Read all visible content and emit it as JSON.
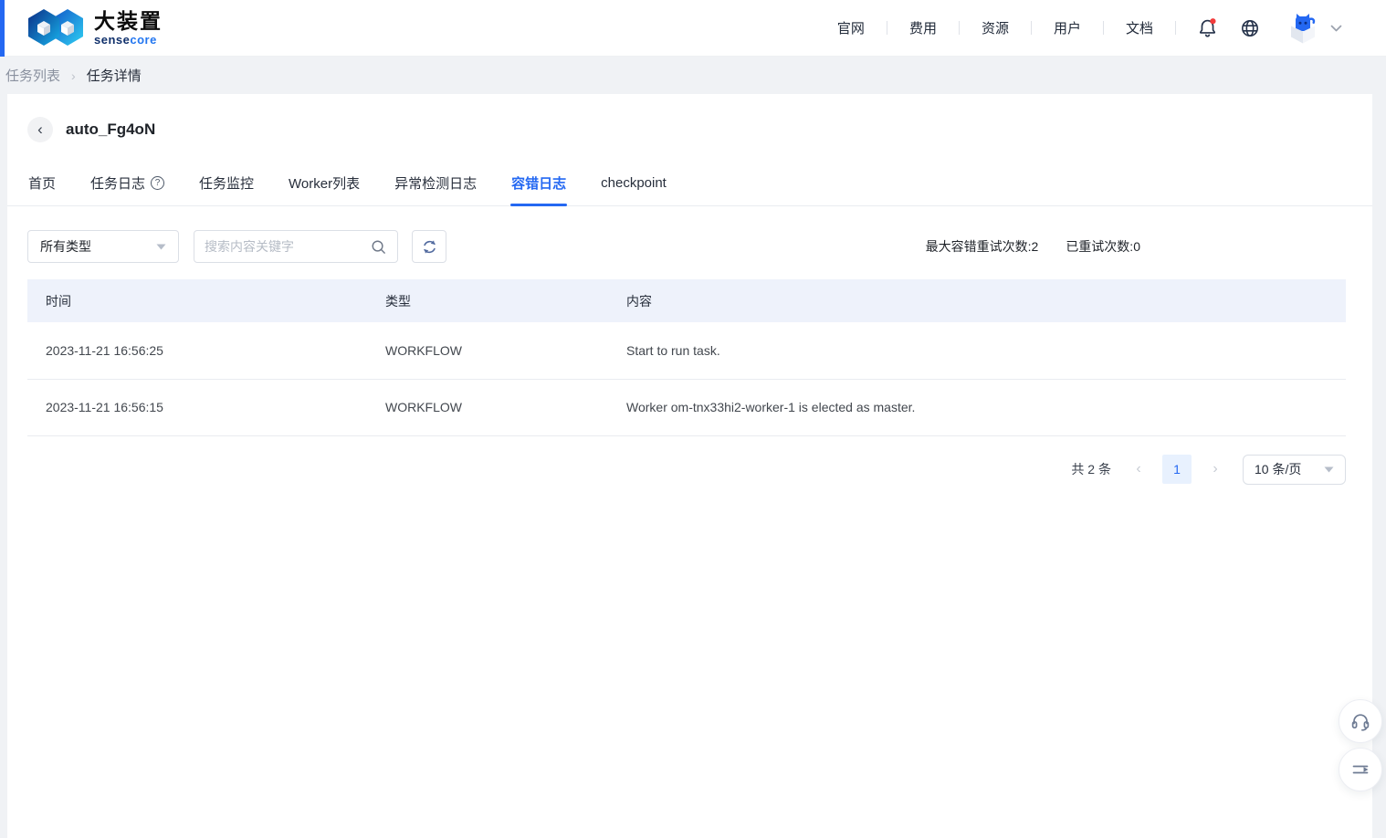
{
  "header": {
    "brand": {
      "name": "大装置",
      "sub_sense": "sense",
      "sub_core": "core"
    },
    "nav": [
      "官网",
      "费用",
      "资源",
      "用户",
      "文档"
    ],
    "avatar_chevron": "v"
  },
  "breadcrumb": {
    "items": [
      "任务列表",
      "任务详情"
    ],
    "separator": "›"
  },
  "page": {
    "back_icon": "‹",
    "title": "auto_Fg4oN"
  },
  "tabs": [
    {
      "label": "首页"
    },
    {
      "label": "任务日志",
      "help_icon": "?"
    },
    {
      "label": "任务监控"
    },
    {
      "label": "Worker列表"
    },
    {
      "label": "异常检测日志"
    },
    {
      "label": "容错日志",
      "active": true
    },
    {
      "label": "checkpoint"
    }
  ],
  "toolbar": {
    "type_filter_value": "所有类型",
    "search_placeholder": "搜索内容关键字",
    "stats": [
      "最大容错重试次数:2",
      "已重试次数:0"
    ]
  },
  "table": {
    "columns": [
      "时间",
      "类型",
      "内容"
    ],
    "rows": [
      {
        "time": "2023-11-21 16:56:25",
        "type": "WORKFLOW",
        "content": "Start to run task."
      },
      {
        "time": "2023-11-21 16:56:15",
        "type": "WORKFLOW",
        "content": "Worker om-tnx33hi2-worker-1 is elected as master."
      }
    ]
  },
  "pagination": {
    "total": "共 2 条",
    "prev_icon": "‹",
    "page": "1",
    "next_icon": "›",
    "page_size": "10 条/页"
  },
  "colors": {
    "accent": "#2468f2",
    "notification_dot": "#f23c3c",
    "table_header_bg": "#eef2fb",
    "page_bg": "#f0f2f5"
  }
}
